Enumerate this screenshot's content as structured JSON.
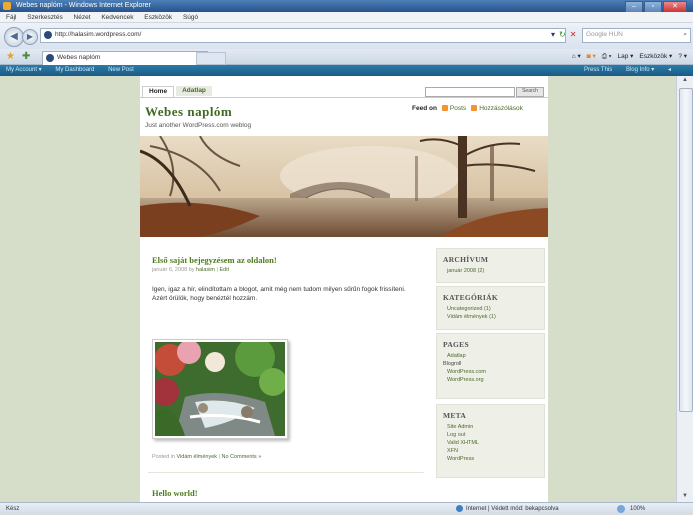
{
  "window": {
    "title": "Webes naplóm - Windows Internet Explorer",
    "buttons": [
      "–",
      "▫",
      "✕"
    ]
  },
  "menu": [
    "Fájl",
    "Szerkesztés",
    "Nézet",
    "Kedvencek",
    "Eszközök",
    "Súgó"
  ],
  "address": {
    "url": "http://halasim.wordpress.com/",
    "search_placeholder": "Google HUN"
  },
  "tab": {
    "label": "Webes naplóm"
  },
  "commandbar": {
    "page": "Lap ▾",
    "tools": "Eszközök ▾"
  },
  "wpbar": {
    "left": [
      "My Account ▾",
      "My Dashboard",
      "New Post"
    ],
    "right": [
      "Press This",
      "Blog Info ▾"
    ]
  },
  "blog": {
    "nav": [
      "Home",
      "Adatlap"
    ],
    "search_button": "Search",
    "title": "Webes naplóm",
    "tagline": "Just another WordPress.com weblog",
    "feed_label": "Feed on",
    "feeds": [
      "Posts",
      "Hozzászólások"
    ]
  },
  "posts": [
    {
      "title": "Első saját bejegyzésem az oldalon!",
      "meta_date": "január 6, 2008 by",
      "meta_author": "halasim",
      "meta_edit": "Edit",
      "body": "Igen, igaz a hír, elindítottam a blogot, amit még nem tudom milyen sűrűn fogok frissíteni. Azért örülök, hogy benéztél hozzám.",
      "foot_prefix": "Posted in",
      "foot_cat": "Vidám élmények",
      "foot_comments": "No Comments »"
    },
    {
      "title": "Hello world!"
    }
  ],
  "sidebar": [
    {
      "heading": "Archívum",
      "items": [
        "január 2008 (2)"
      ]
    },
    {
      "heading": "Kategóriák",
      "items": [
        "Uncategorized (1)",
        "Vidám élmények (1)"
      ]
    },
    {
      "heading": "Pages",
      "items": [
        "Adatlap"
      ],
      "sub": "Blogroll",
      "sub_items": [
        "WordPress.com",
        "WordPress.org"
      ]
    },
    {
      "heading": "Meta",
      "items": [
        "Site Admin",
        "Log out",
        "Valid XHTML",
        "XFN",
        "WordPress"
      ]
    }
  ],
  "status": {
    "left": "Kész",
    "zone": "Internet | Védett mód: bekapcsolva",
    "zoom": "100%"
  }
}
